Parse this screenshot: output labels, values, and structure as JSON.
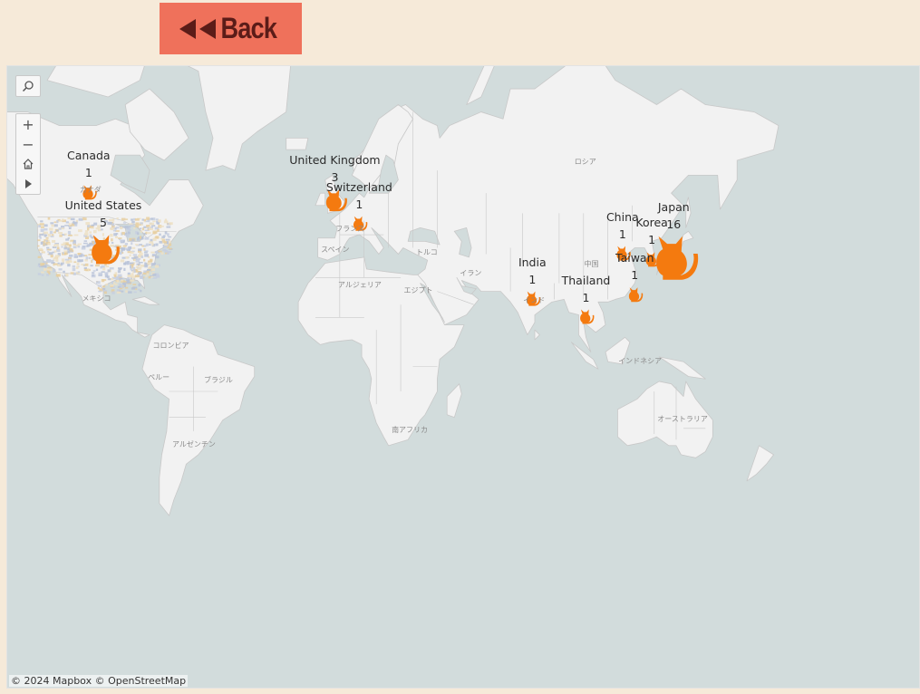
{
  "back_button": {
    "label": "Back"
  },
  "map": {
    "attribution": "© 2024 Mapbox © OpenStreetMap",
    "colors": {
      "water": "#d2dcdc",
      "land": "#f2f2f2",
      "border": "#c8c8c8",
      "marker": "#f47a0f"
    },
    "toolbar": {
      "search_icon": "magnifier-icon",
      "zoom_in_icon": "plus-icon",
      "zoom_out_icon": "minus-icon",
      "home_icon": "home-icon",
      "pan_icon": "play-triangle-icon"
    },
    "markers": [
      {
        "country": "Canada",
        "count": "1",
        "lon": -103,
        "lat": 55,
        "size": 0.5
      },
      {
        "country": "United States",
        "count": "5",
        "lon": -97,
        "lat": 39,
        "size": 1.0
      },
      {
        "country": "United Kingdom",
        "count": "3",
        "lon": -2,
        "lat": 53,
        "size": 0.75
      },
      {
        "country": "Switzerland",
        "count": "1",
        "lon": 8,
        "lat": 47,
        "size": 0.5
      },
      {
        "country": "India",
        "count": "1",
        "lon": 79,
        "lat": 22,
        "size": 0.5
      },
      {
        "country": "China",
        "count": "1",
        "lon": 116,
        "lat": 38,
        "size": 0.5
      },
      {
        "country": "Korea",
        "count": "1",
        "lon": 128,
        "lat": 36,
        "size": 0.5
      },
      {
        "country": "Japan",
        "count": "16",
        "lon": 137,
        "lat": 36,
        "size": 1.5
      },
      {
        "country": "Taiwan",
        "count": "1",
        "lon": 121,
        "lat": 23.5,
        "size": 0.5
      },
      {
        "country": "Thailand",
        "count": "1",
        "lon": 101,
        "lat": 15,
        "size": 0.5
      }
    ],
    "place_labels": [
      {
        "text": "ロシア",
        "lon": 100,
        "lat": 62
      },
      {
        "text": "カナダ",
        "lon": -103,
        "lat": 56
      },
      {
        "text": "フランス",
        "lon": 2,
        "lat": 46
      },
      {
        "text": "スペイン",
        "lon": -4,
        "lat": 40
      },
      {
        "text": "トルコ",
        "lon": 35,
        "lat": 39
      },
      {
        "text": "イラン",
        "lon": 53,
        "lat": 32
      },
      {
        "text": "中国",
        "lon": 104,
        "lat": 35
      },
      {
        "text": "インド",
        "lon": 79,
        "lat": 22
      },
      {
        "text": "アルジェリア",
        "lon": 3,
        "lat": 28
      },
      {
        "text": "エジプト",
        "lon": 30,
        "lat": 26
      },
      {
        "text": "メキシコ",
        "lon": -102,
        "lat": 23
      },
      {
        "text": "コロンビア",
        "lon": -73,
        "lat": 4
      },
      {
        "text": "ペルー",
        "lon": -75,
        "lat": -9
      },
      {
        "text": "ブラジル",
        "lon": -52,
        "lat": -10
      },
      {
        "text": "アルゼンチン",
        "lon": -65,
        "lat": -34
      },
      {
        "text": "南アフリカ",
        "lon": 25,
        "lat": -29
      },
      {
        "text": "インドネシア",
        "lon": 118,
        "lat": -2
      },
      {
        "text": "オーストラリア",
        "lon": 134,
        "lat": -25
      }
    ]
  }
}
